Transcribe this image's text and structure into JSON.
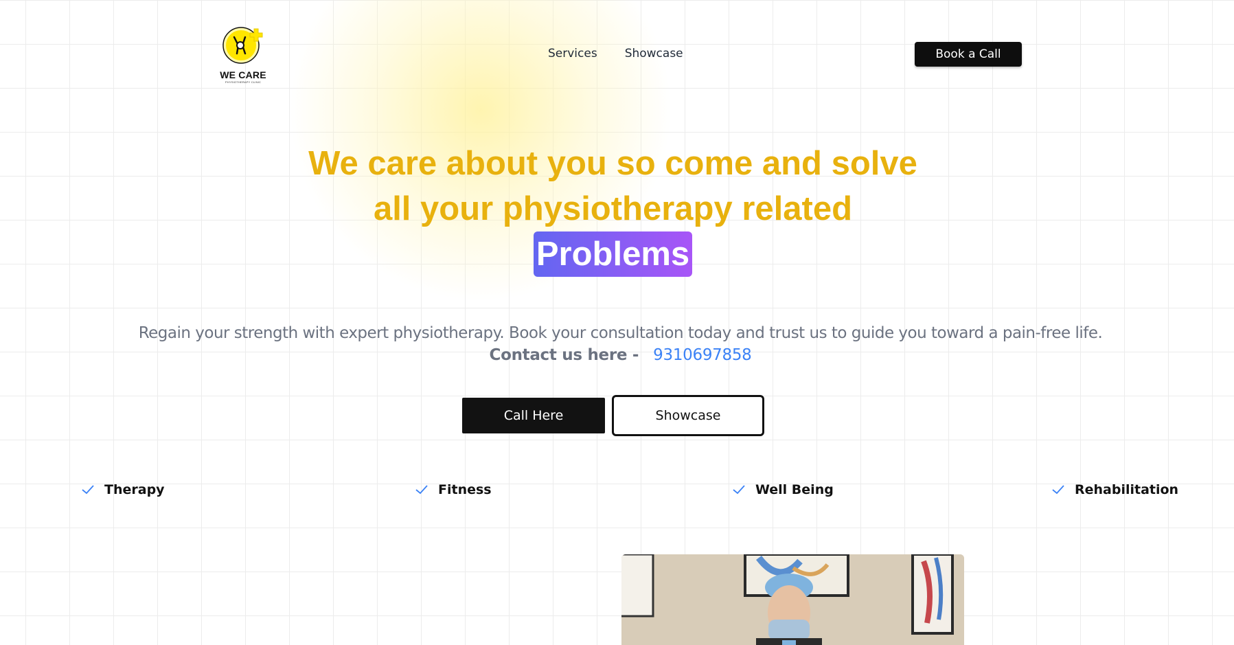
{
  "logo": {
    "title": "WE CARE",
    "subtitle": "PHYSIOTHERAPY CLINIC",
    "icon": "knee-joint-icon",
    "accent": "#ffe600"
  },
  "nav": {
    "items": [
      {
        "label": "Services"
      },
      {
        "label": "Showcase"
      }
    ],
    "cta_label": "Book a Call"
  },
  "hero": {
    "heading_line1": "We care about you so come and solve",
    "heading_line2": "all your physiotherapy related",
    "heading_highlight": "Problems",
    "subtext": "Regain your strength with expert physiotherapy. Book your consultation today and trust us to guide you toward a pain-free life.",
    "contact_label": "Contact us here -",
    "contact_phone": "9310697858",
    "primary_button": "Call Here",
    "secondary_button": "Showcase"
  },
  "features": [
    {
      "label": "Therapy",
      "icon": "check-icon"
    },
    {
      "label": "Fitness",
      "icon": "check-icon"
    },
    {
      "label": "Well Being",
      "icon": "check-icon"
    },
    {
      "label": "Rehabilitation",
      "icon": "check-icon"
    }
  ],
  "colors": {
    "heading": "#e8b10e",
    "highlight_start": "#6366f1",
    "highlight_end": "#a855f7",
    "link": "#3b82f6",
    "check": "#3b82f6"
  }
}
